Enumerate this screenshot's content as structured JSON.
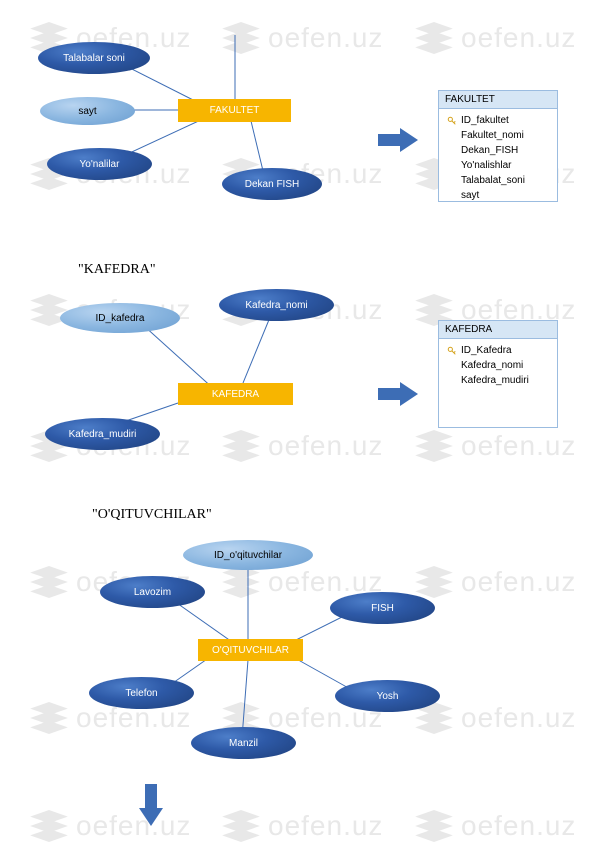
{
  "watermark_text": "oefen.uz",
  "section1": {
    "nodes": {
      "talabalar": "Talabalar soni",
      "sayt": "sayt",
      "yonalilar": "Yo'nalilar",
      "fakultet": "FAKULTET",
      "dekan": "Dekan FISH"
    },
    "table": {
      "title": "FAKULTET",
      "key": "ID_fakultet",
      "fields": [
        "Fakultet_nomi",
        "Dekan_FISH",
        "Yo'nalishlar",
        "Talabalat_soni",
        "sayt"
      ]
    }
  },
  "section2": {
    "title": "\"KAFEDRA\"",
    "nodes": {
      "id_kafedra": "ID_kafedra",
      "kafedra_nomi": "Kafedra_nomi",
      "kafedra": "KAFEDRA",
      "kafedra_mudiri": "Kafedra_mudiri"
    },
    "table": {
      "title": "KAFEDRA",
      "key": "ID_Kafedra",
      "fields": [
        "Kafedra_nomi",
        "Kafedra_mudiri"
      ]
    }
  },
  "section3": {
    "title": "\"O'QITUVCHILAR\"",
    "nodes": {
      "id_oqituvchilar": "ID_o'qituvchilar",
      "lavozim": "Lavozim",
      "fish": "FISH",
      "oqituvchilar": "O'QITUVCHILAR",
      "telefon": "Telefon",
      "yosh": "Yosh",
      "manzil": "Manzil"
    }
  }
}
